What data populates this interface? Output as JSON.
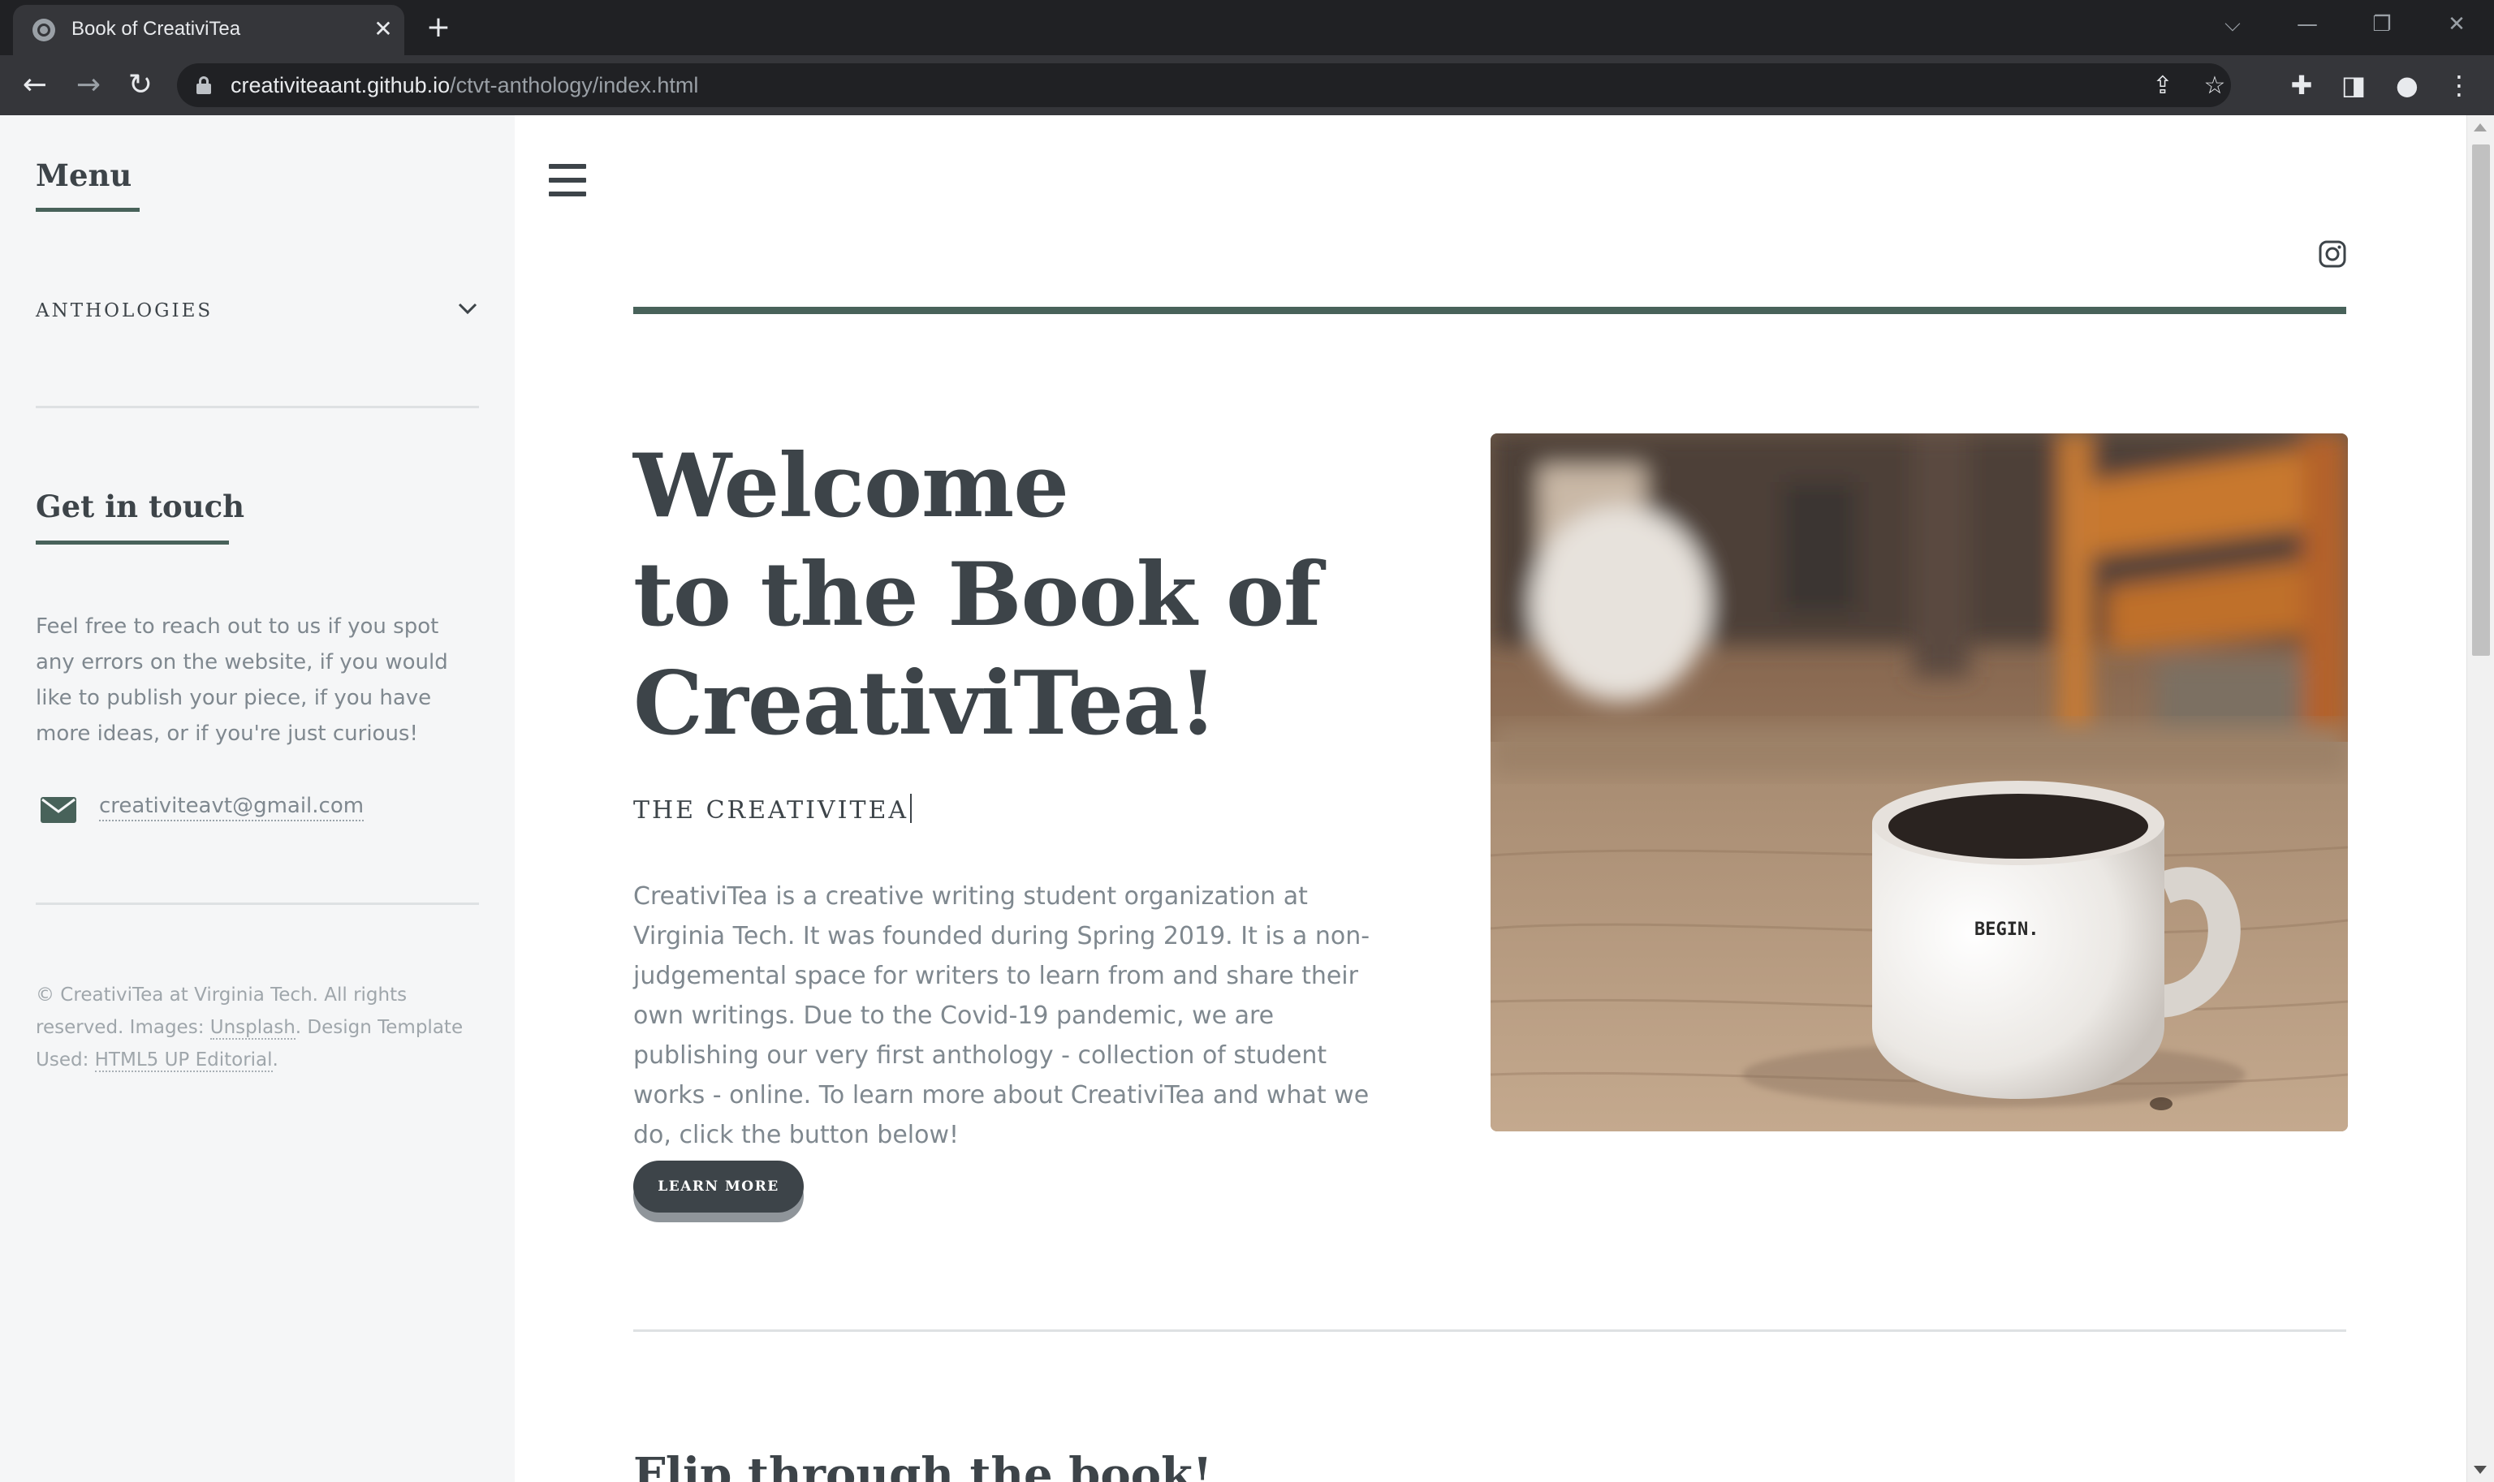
{
  "browser": {
    "tab_title": "Book of CreativiTea",
    "tab_close": "✕",
    "new_tab": "+",
    "window_controls": {
      "tab_search": "⌵",
      "minimize": "—",
      "restore": "❐",
      "close": "✕"
    },
    "nav": {
      "back": "←",
      "forward": "→",
      "reload": "↻"
    },
    "url_host": "creativiteaant.github.io",
    "url_path": "/ctvt-anthology/index.html",
    "icons": [
      "share-icon",
      "star-icon",
      "extensions-icon",
      "side-panel-icon",
      "profile-icon",
      "menu-icon"
    ],
    "icon_glyphs": {
      "share": "⇪",
      "star": "☆",
      "extensions": "✚",
      "side_panel": "◨",
      "profile": "●",
      "menu": "⋮"
    }
  },
  "sidebar": {
    "menu_heading": "Menu",
    "anthologies_label": "ANTHOLOGIES",
    "contact_heading": "Get in touch",
    "contact_text": "Feel free to reach out to us if you spot any errors on the website, if you would like to publish your piece, if you have more ideas, or if you're just curious!",
    "email": "creativiteavt@gmail.com",
    "footer": {
      "copyright": "© CreativiTea at Virginia Tech. All rights reserved. Images: ",
      "unsplash_link": "Unsplash",
      "template_text": ". Design Template Used: ",
      "template_link": "HTML5 UP Editorial",
      "end": "."
    }
  },
  "main": {
    "hero_title_line1": "Welcome",
    "hero_title_line2": "to the Book of",
    "hero_title_line3": "CreativiTea!",
    "hero_subtitle": "THE CREATIVITEA",
    "hero_body": "CreativiTea is a creative writing student organization at Virginia Tech. It was founded during Spring 2019. It is a non-judgemental space for writers to learn from and share their own writings. Due to the Covid-19 pandemic, we are publishing our very first anthology - collection of student works - online. To learn more about CreativiTea and what we do, click the button below!",
    "button_label": "LEARN MORE",
    "mug_text": "BEGIN.",
    "next_section_title": "Flip through the book!"
  },
  "colors": {
    "accent": "#48625a",
    "text_dark": "#3d4449",
    "text_muted": "#7f888f",
    "sidebar_bg": "#f5f6f7"
  }
}
